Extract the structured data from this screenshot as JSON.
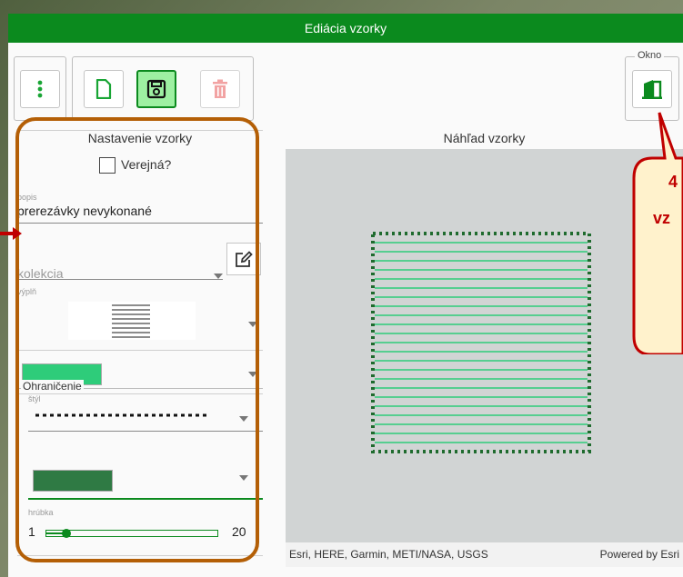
{
  "dialog": {
    "title": "Ediácia vzorky"
  },
  "toolbar": {
    "menu_icon": "vertical-dots-icon",
    "new_icon": "new-file-icon",
    "save_icon": "save-icon",
    "delete_icon": "trash-icon",
    "window_legend": "Okno",
    "window_icon": "exit-door-icon"
  },
  "settings": {
    "title": "Nastavenie vzorky",
    "public_label": "Verejná?",
    "public_checked": false,
    "description_label": "popis",
    "description_value": "prerezávky nevykonané",
    "collection_placeholder": "kolekcia",
    "fill_label": "výplň",
    "fill_color": "#2ecc7a",
    "border_legend": "Ohraničenie",
    "style_label": "štýl",
    "border_color": "#2f7a44",
    "thickness_label": "hrúbka",
    "thickness_min": "1",
    "thickness_max": "20",
    "thickness_value": 1
  },
  "preview": {
    "title": "Náhľad vzorky",
    "attribution": "Esri, HERE, Garmin, METI/NASA, USGS",
    "powered_by": "Powered by Esri",
    "stroke_color": "#1f6b2e",
    "hatch_color": "#2ecc7a"
  },
  "callout": {
    "line1": "4",
    "line2": "vz"
  },
  "colors": {
    "accent": "#0b8a1e",
    "annotation": "#b45f06"
  }
}
